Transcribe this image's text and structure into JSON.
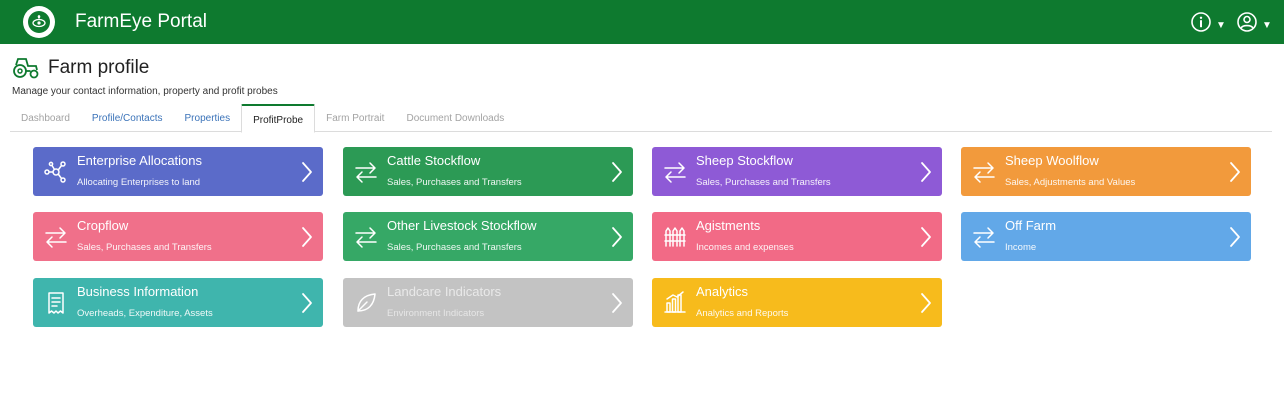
{
  "header": {
    "title": "FarmEye Portal",
    "brand_color": "#0e7a2f"
  },
  "page": {
    "title": "Farm profile",
    "subtitle": "Manage your contact information, property and profit probes"
  },
  "tabs": [
    {
      "label": "Dashboard",
      "state": "muted"
    },
    {
      "label": "Profile/Contacts",
      "state": "link"
    },
    {
      "label": "Properties",
      "state": "link"
    },
    {
      "label": "ProfitProbe",
      "state": "active"
    },
    {
      "label": "Farm Portrait",
      "state": "muted"
    },
    {
      "label": "Document Downloads",
      "state": "muted"
    }
  ],
  "tiles": [
    {
      "title": "Enterprise Allocations",
      "subtitle": "Allocating Enterprises to land",
      "color": "#5b6bc9",
      "icon": "network-icon"
    },
    {
      "title": "Cattle Stockflow",
      "subtitle": "Sales, Purchases and Transfers",
      "color": "#2c9a55",
      "icon": "transfer-arrows-icon"
    },
    {
      "title": "Sheep Stockflow",
      "subtitle": "Sales, Purchases and Transfers",
      "color": "#8e5ad6",
      "icon": "transfer-arrows-icon"
    },
    {
      "title": "Sheep Woolflow",
      "subtitle": "Sales, Adjustments and Values",
      "color": "#f29a3c",
      "icon": "transfer-arrows-icon"
    },
    {
      "title": "Cropflow",
      "subtitle": "Sales, Purchases and Transfers",
      "color": "#f0708a",
      "icon": "transfer-arrows-icon"
    },
    {
      "title": "Other Livestock Stockflow",
      "subtitle": "Sales, Purchases and Transfers",
      "color": "#36a866",
      "icon": "transfer-arrows-icon"
    },
    {
      "title": "Agistments",
      "subtitle": "Incomes and expenses",
      "color": "#f26a86",
      "icon": "fence-icon"
    },
    {
      "title": "Off Farm",
      "subtitle": "Income",
      "color": "#62a8e8",
      "icon": "transfer-arrows-icon"
    },
    {
      "title": "Business Information",
      "subtitle": "Overheads, Expenditure, Assets",
      "color": "#3fb5ad",
      "icon": "receipt-icon"
    },
    {
      "title": "Landcare Indicators",
      "subtitle": "Environment Indicators",
      "color": "#b9b9b9",
      "icon": "leaf-icon",
      "disabled": true
    },
    {
      "title": "Analytics",
      "subtitle": "Analytics and Reports",
      "color": "#f7bb1c",
      "icon": "bar-chart-icon"
    }
  ]
}
